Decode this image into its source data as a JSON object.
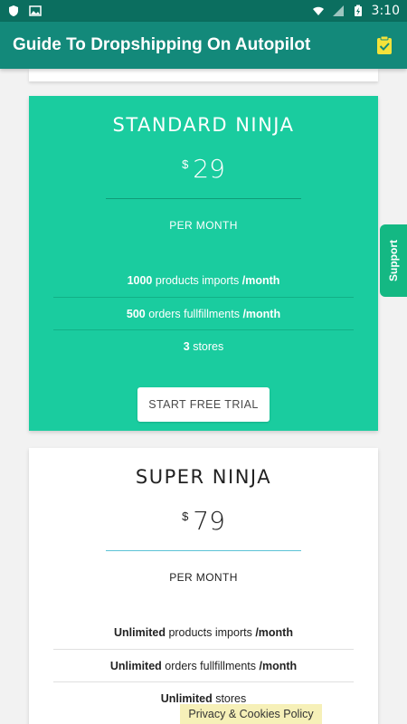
{
  "status_bar": {
    "time": "3:10"
  },
  "app_bar": {
    "title": "Guide To Dropshipping On Autopilot",
    "action_icon": "clipboard-check-icon"
  },
  "plans": [
    {
      "name": "STANDARD NINJA",
      "currency": "$",
      "amount": "29",
      "period": "PER MONTH",
      "features": [
        {
          "strong": "1000",
          "text": " products imports ",
          "suffix": "/month"
        },
        {
          "strong": "500",
          "text": " orders fullfillments ",
          "suffix": "/month"
        },
        {
          "strong": "3",
          "text": " stores",
          "suffix": ""
        }
      ],
      "cta": "START FREE TRIAL",
      "color": "#1acc9f"
    },
    {
      "name": "SUPER NINJA",
      "currency": "$",
      "amount": "79",
      "period": "PER MONTH",
      "features": [
        {
          "strong": "Unlimited",
          "text": " products imports ",
          "suffix": "/month"
        },
        {
          "strong": "Unlimited",
          "text": " orders fullfillments ",
          "suffix": "/month"
        },
        {
          "strong": "Unlimited",
          "text": " stores",
          "suffix": ""
        }
      ],
      "color": "#ffffff"
    }
  ],
  "support_tab": {
    "label": "Support"
  },
  "cookie_banner": {
    "label": "Privacy & Cookies Policy"
  },
  "colors": {
    "status_bar": "#0b6e5f",
    "app_bar": "#13897a",
    "standard_card": "#1acc9f",
    "support_tab": "#14b883"
  }
}
